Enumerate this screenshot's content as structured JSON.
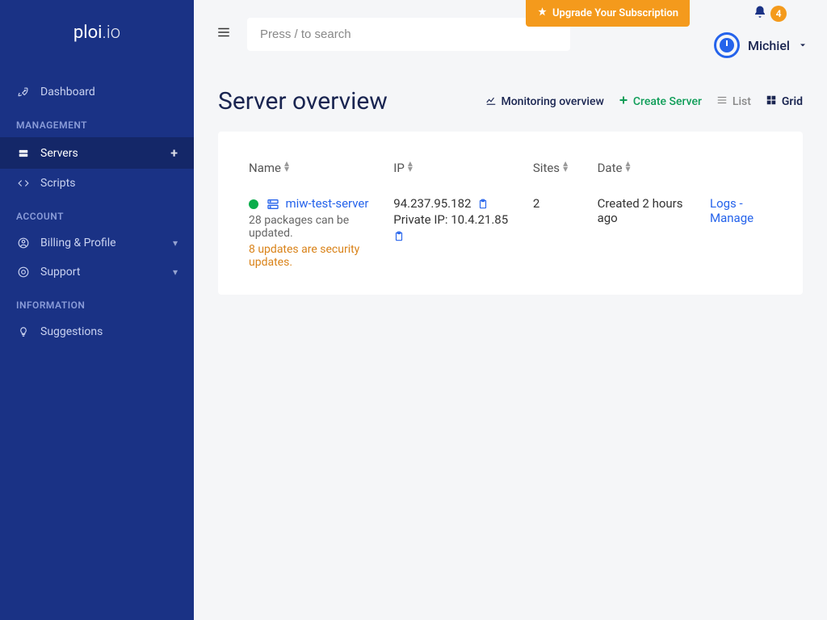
{
  "logo": {
    "part1": "ploi",
    "part2": ".io"
  },
  "sidebar": {
    "dashboard": "Dashboard",
    "section_management": "MANAGEMENT",
    "servers": "Servers",
    "scripts": "Scripts",
    "section_account": "ACCOUNT",
    "billing": "Billing & Profile",
    "support": "Support",
    "section_information": "INFORMATION",
    "suggestions": "Suggestions"
  },
  "topbar": {
    "search_placeholder": "Press / to search",
    "upgrade": "Upgrade Your Subscription",
    "notif_count": "4",
    "user_name": "Michiel"
  },
  "page": {
    "title": "Server overview",
    "monitoring": "Monitoring overview",
    "create_server": "Create Server",
    "list": "List",
    "grid": "Grid"
  },
  "table": {
    "col_name": "Name",
    "col_ip": "IP",
    "col_sites": "Sites",
    "col_date": "Date",
    "row": {
      "server_name": "miw-test-server",
      "packages": "28 packages can be updated.",
      "security": "8 updates are security updates.",
      "public_ip": "94.237.95.182",
      "private_ip": "Private IP: 10.4.21.85",
      "sites": "2",
      "date": "Created 2 hours ago",
      "logs": "Logs",
      "manage": "Manage"
    }
  }
}
